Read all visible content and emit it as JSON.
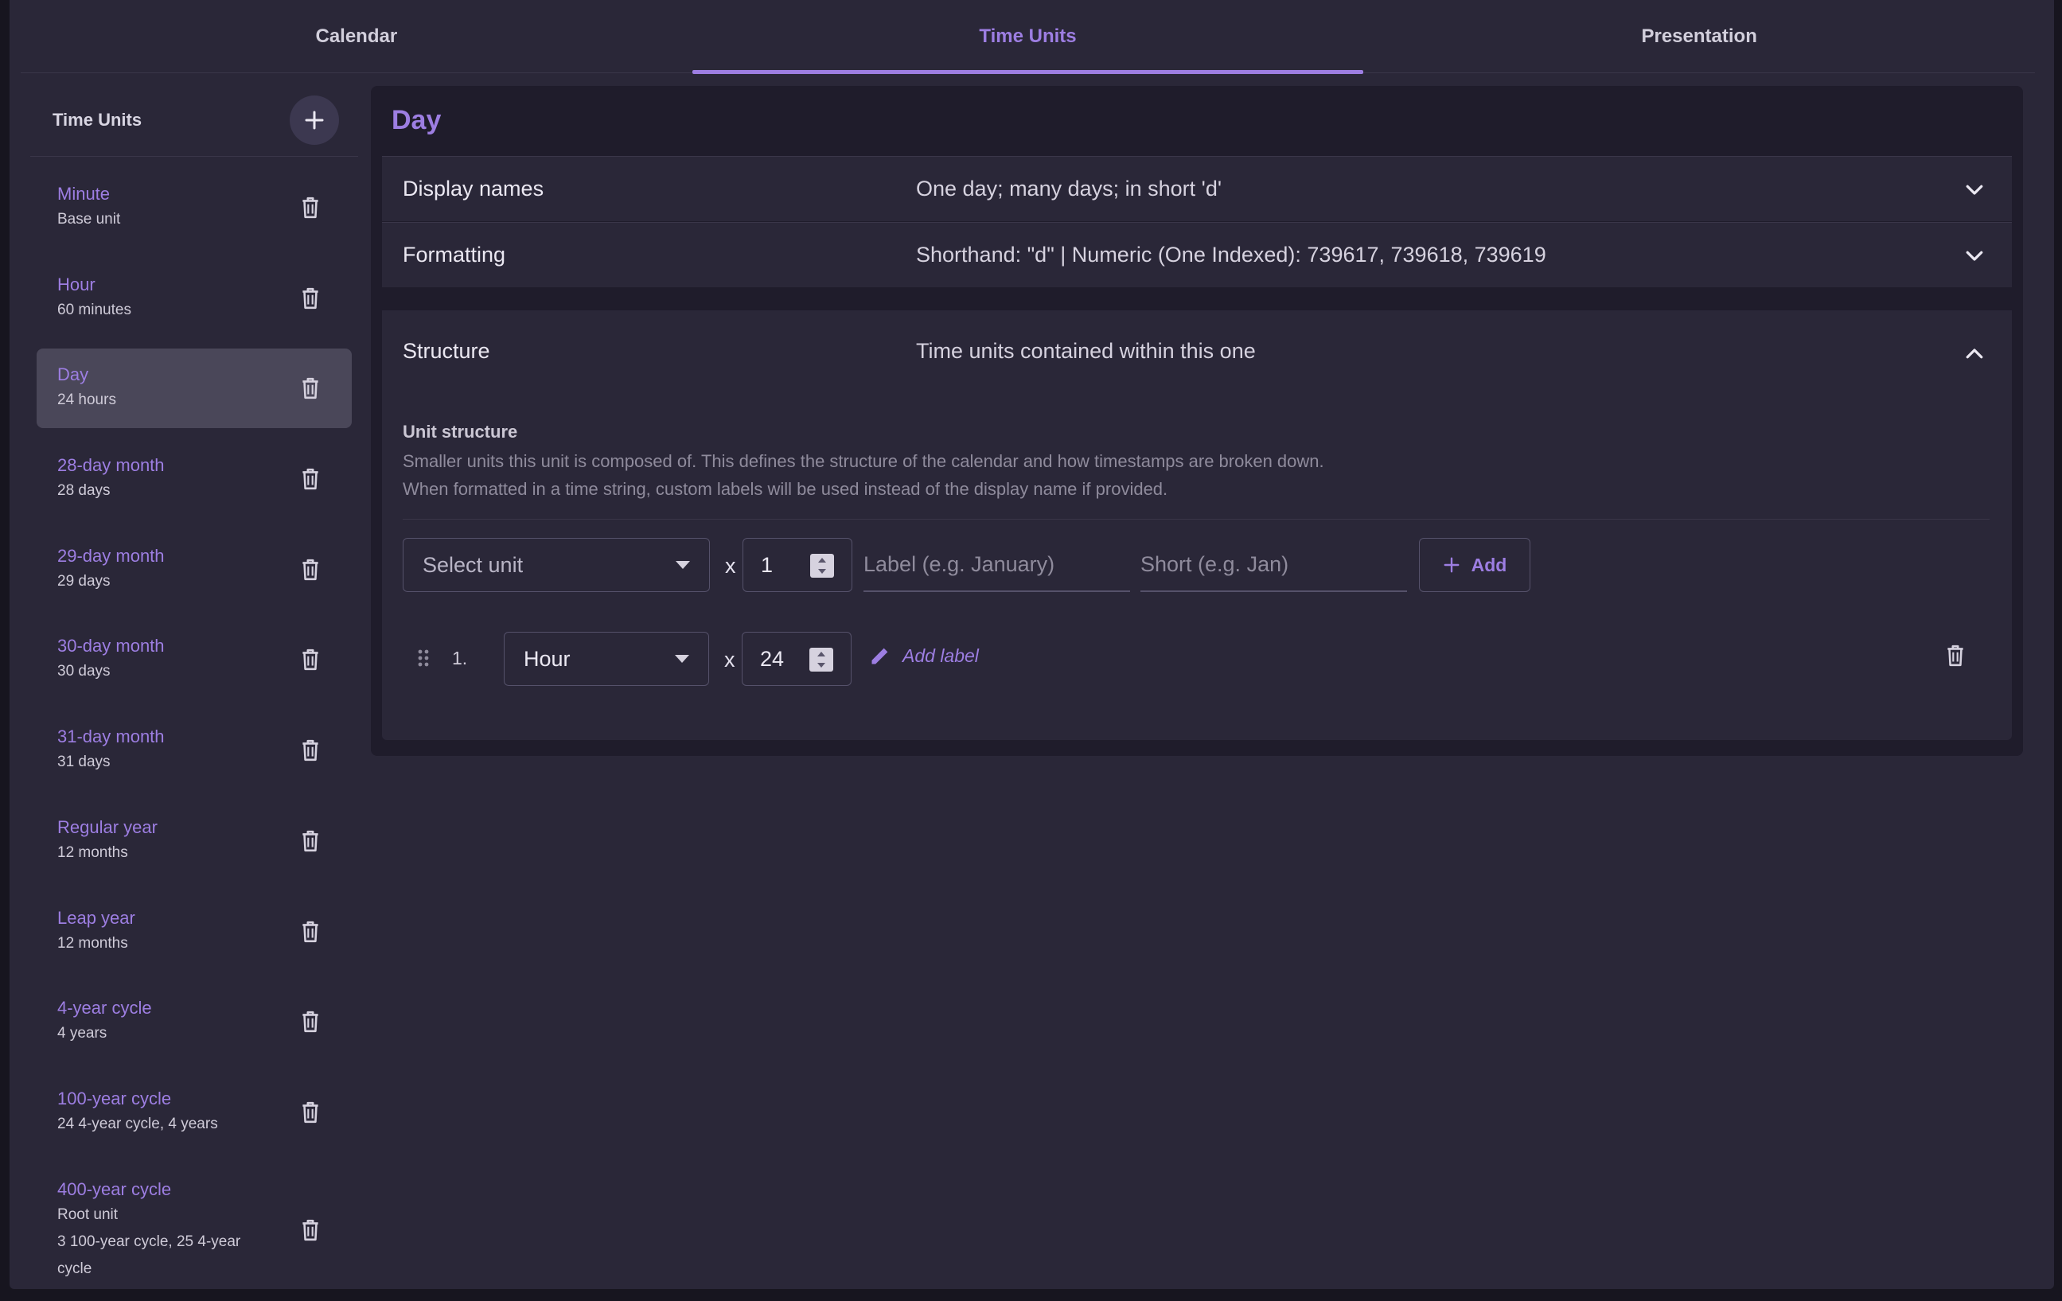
{
  "tabs": [
    "Calendar",
    "Time Units",
    "Presentation"
  ],
  "active_tab": "Time Units",
  "sidebar": {
    "title": "Time Units",
    "add_icon": "plus-icon",
    "delete_icon": "trash-icon",
    "selected": "Day",
    "items": [
      {
        "name": "Minute",
        "details": [
          "Base unit"
        ]
      },
      {
        "name": "Hour",
        "details": [
          "60 minutes"
        ]
      },
      {
        "name": "Day",
        "details": [
          "24 hours"
        ]
      },
      {
        "name": "28-day month",
        "details": [
          "28 days"
        ]
      },
      {
        "name": "29-day month",
        "details": [
          "29 days"
        ]
      },
      {
        "name": "30-day month",
        "details": [
          "30 days"
        ]
      },
      {
        "name": "31-day month",
        "details": [
          "31 days"
        ]
      },
      {
        "name": "Regular year",
        "details": [
          "12 months"
        ]
      },
      {
        "name": "Leap year",
        "details": [
          "12 months"
        ]
      },
      {
        "name": "4-year cycle",
        "details": [
          "4 years"
        ]
      },
      {
        "name": "100-year cycle",
        "details": [
          "24 4-year cycle, 4 years"
        ]
      },
      {
        "name": "400-year cycle",
        "details": [
          "Root unit",
          "3 100-year cycle, 25 4-year",
          "cycle"
        ]
      }
    ]
  },
  "panel": {
    "title": "Day",
    "display_names": {
      "label": "Display names",
      "value": "One day; many days; in short 'd'"
    },
    "formatting": {
      "label": "Formatting",
      "value": "Shorthand: \"d\" | Numeric (One Indexed): 739617, 739618, 739619"
    },
    "structure": {
      "label": "Structure",
      "value": "Time units contained within this one",
      "unit_structure_title": "Unit structure",
      "help_line1": "Smaller units this unit is composed of. This defines the structure of the calendar and how timestamps are broken down.",
      "help_line2": "When formatted in a time string, custom labels will be used instead of the display name if provided.",
      "new_entry": {
        "select_placeholder": "Select unit",
        "times": "x",
        "count": "1",
        "label_placeholder": "Label (e.g. January)",
        "short_placeholder": "Short (e.g. Jan)",
        "add_label": "Add"
      },
      "entries": [
        {
          "index": "1.",
          "unit": "Hour",
          "times": "x",
          "count": "24",
          "add_label": "Add label"
        }
      ]
    }
  },
  "colors": {
    "accent": "#9d7ee2",
    "background": "#2a2738",
    "panel": "#1f1c2b",
    "selected": "#4a4759"
  }
}
